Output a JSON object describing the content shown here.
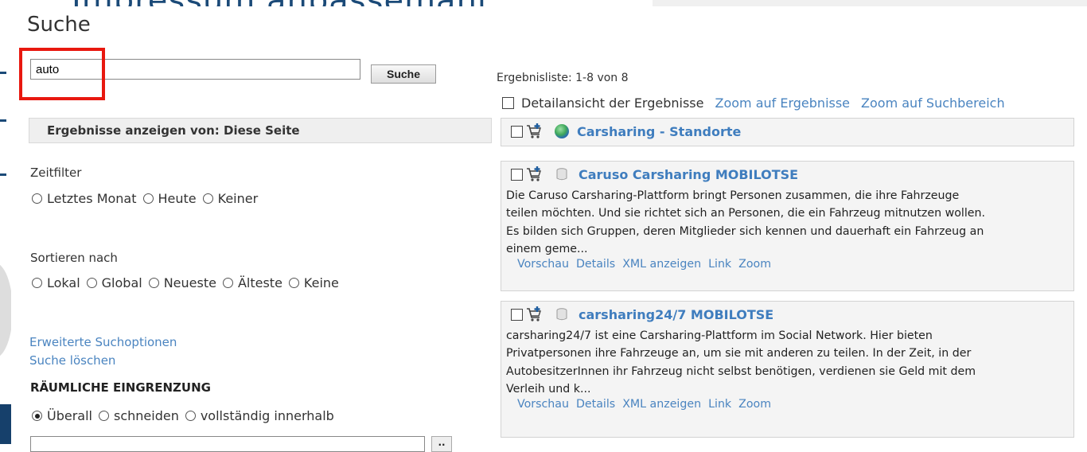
{
  "background": {
    "title_fragment": "Impressum anbassemant"
  },
  "dialog": {
    "title": "Suche",
    "search": {
      "value": "auto",
      "button_label": "Suche"
    },
    "results_from": "Ergebnisse anzeigen von: Diese Seite",
    "time_filter": {
      "label": "Zeitfilter",
      "options": [
        "Letztes Monat",
        "Heute",
        "Keiner"
      ]
    },
    "sort": {
      "label": "Sortieren nach",
      "options": [
        "Lokal",
        "Global",
        "Neueste",
        "Älteste",
        "Keine"
      ]
    },
    "advanced_link": "Erweiterte Suchoptionen",
    "clear_link": "Suche löschen",
    "spatial": {
      "heading": "RÄUMLICHE EINGRENZUNG",
      "options": [
        "Überall",
        "schneiden",
        "vollständig innerhalb"
      ],
      "selected": "Überall"
    },
    "result_count": "Ergebnisliste: 1-8 von 8",
    "detail_view": "Detailansicht der Ergebnisse",
    "zoom_results": "Zoom auf Ergebnisse",
    "zoom_area": "Zoom auf Suchbereich",
    "results": [
      {
        "title": "Carsharing - Standorte",
        "icon": "globe-icon"
      },
      {
        "title": "Caruso Carsharing MOBILOTSE",
        "icon": "database-icon",
        "description": [
          "Die Caruso Carsharing-Plattform bringt Personen zusammen, die ihre Fahrzeuge",
          "teilen möchten. Und sie richtet sich an Personen, die ein Fahrzeug mitnutzen wollen.",
          "Es bilden sich Gruppen, deren Mitglieder sich kennen und dauerhaft ein Fahrzeug an",
          "einem geme..."
        ],
        "links": [
          "Vorschau",
          "Details",
          "XML anzeigen",
          "Link",
          "Zoom"
        ]
      },
      {
        "title": "carsharing24/7 MOBILOTSE",
        "icon": "database-icon",
        "description": [
          "carsharing24/7 ist eine Carsharing-Plattform im Social Network. Hier bieten",
          "Privatpersonen ihre Fahrzeuge an, um sie mit anderen zu teilen. In der Zeit, in der",
          "AutobesitzerInnen ihr Fahrzeug nicht selbst benötigen, verdienen sie Geld mit dem",
          "Verleih und k..."
        ],
        "links": [
          "Vorschau",
          "Details",
          "XML anzeigen",
          "Link",
          "Zoom"
        ]
      }
    ],
    "colors": {
      "link": "#4a84c0",
      "highlight": "#e8180f",
      "card_bg": "#f4f4f4"
    }
  }
}
